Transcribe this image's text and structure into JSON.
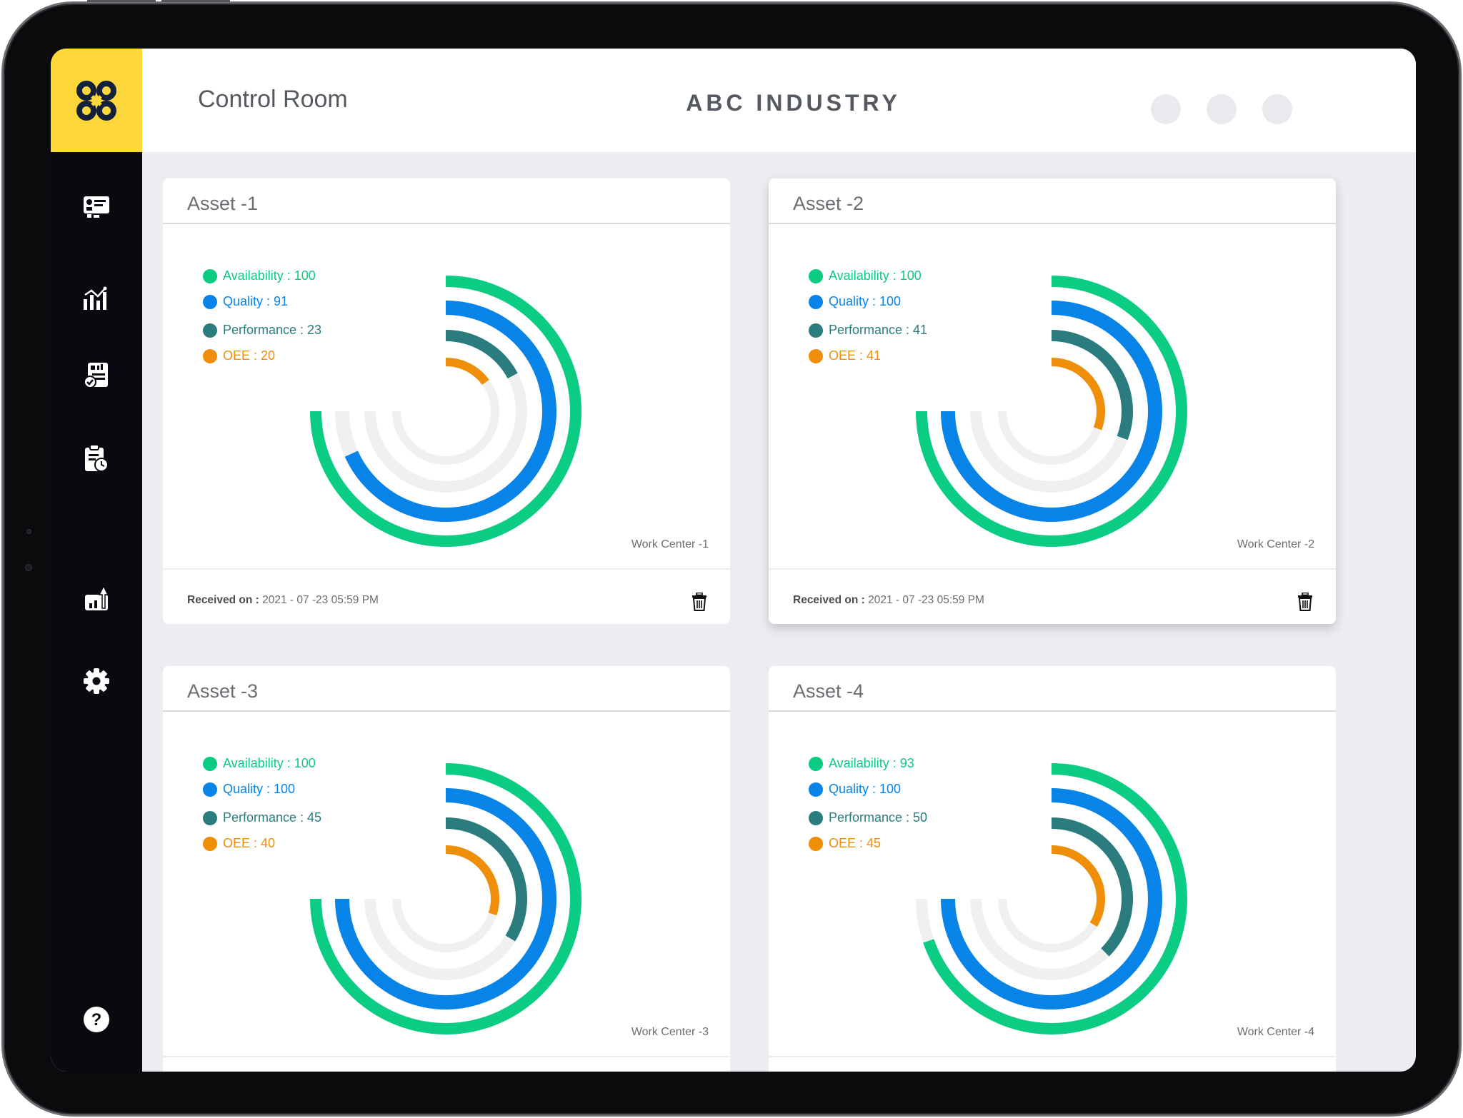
{
  "app": {
    "page_title": "Control Room",
    "brand_title": "ABC INDUSTRY"
  },
  "sidebar": {
    "items": [
      {
        "icon": "dashboard-card-icon"
      },
      {
        "icon": "analytics-chart-icon"
      },
      {
        "icon": "report-document-icon"
      },
      {
        "icon": "schedule-clipboard-icon"
      },
      {
        "icon": "growth-report-icon"
      },
      {
        "icon": "settings-gear-icon"
      }
    ],
    "help_icon": "help-icon"
  },
  "colors": {
    "availability": "#0acc82",
    "quality": "#0883e8",
    "performance": "#2b7c7f",
    "oee": "#ef8e08",
    "track": "#f0f0f0",
    "logo_bg": "#fed73a"
  },
  "cards": [
    {
      "title": "Asset -1",
      "work_center": "Work Center -1",
      "received_label": "Received on :",
      "received_value": "2021 - 07 -23 05:59 PM",
      "metrics": {
        "availability": {
          "label": "Availability : 100",
          "value": 100
        },
        "quality": {
          "label": "Quality : 91",
          "value": 91
        },
        "performance": {
          "label": "Performance : 23",
          "value": 23
        },
        "oee": {
          "label": "OEE : 20",
          "value": 20
        }
      }
    },
    {
      "title": "Asset -2",
      "work_center": "Work Center -2",
      "received_label": "Received on :",
      "received_value": "2021 - 07 -23 05:59 PM",
      "metrics": {
        "availability": {
          "label": "Availability : 100",
          "value": 100
        },
        "quality": {
          "label": "Quality : 100",
          "value": 100
        },
        "performance": {
          "label": "Performance : 41",
          "value": 41
        },
        "oee": {
          "label": "OEE : 41",
          "value": 41
        }
      }
    },
    {
      "title": "Asset -3",
      "work_center": "Work Center -3",
      "received_label": "",
      "received_value": "",
      "metrics": {
        "availability": {
          "label": "Availability : 100",
          "value": 100
        },
        "quality": {
          "label": "Quality : 100",
          "value": 100
        },
        "performance": {
          "label": "Performance : 45",
          "value": 45
        },
        "oee": {
          "label": "OEE : 40",
          "value": 40
        }
      }
    },
    {
      "title": "Asset -4",
      "work_center": "Work Center -4",
      "received_label": "",
      "received_value": "",
      "metrics": {
        "availability": {
          "label": "Availability : 93",
          "value": 93
        },
        "quality": {
          "label": "Quality : 100",
          "value": 100
        },
        "performance": {
          "label": "Performance : 50",
          "value": 50
        },
        "oee": {
          "label": "OEE : 45",
          "value": 45
        }
      }
    }
  ]
}
